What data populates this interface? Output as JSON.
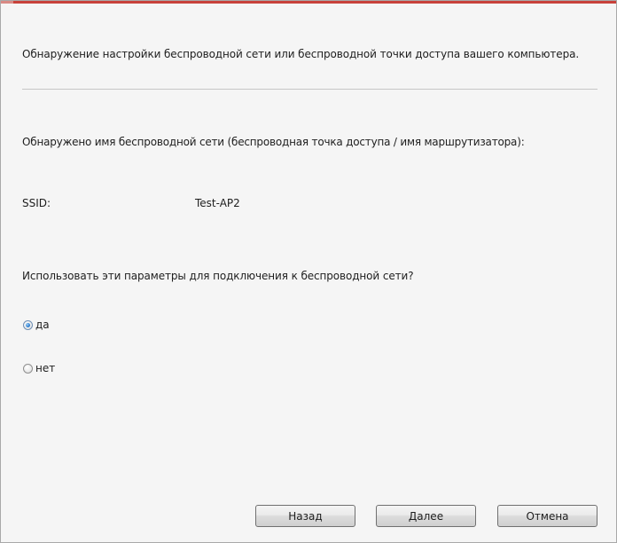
{
  "dialog": {
    "heading": "Обнаружение настройки беспроводной сети или беспроводной точки доступа вашего компьютера.",
    "detected_label": "Обнаружено имя беспроводной сети (беспроводная точка доступа / имя маршрутизатора):",
    "ssid": {
      "label": "SSID:",
      "value": "Test-AP2"
    },
    "question": "Использовать эти параметры для подключения к беспроводной сети?",
    "options": [
      {
        "label": "да",
        "selected": true
      },
      {
        "label": "нет",
        "selected": false
      }
    ]
  },
  "buttons": {
    "back": "Назад",
    "next": "Далее",
    "cancel": "Отмена"
  },
  "colors": {
    "title_accent": "#c8413a",
    "background": "#f5f5f5",
    "radio_selected": "#2f7fd0"
  }
}
